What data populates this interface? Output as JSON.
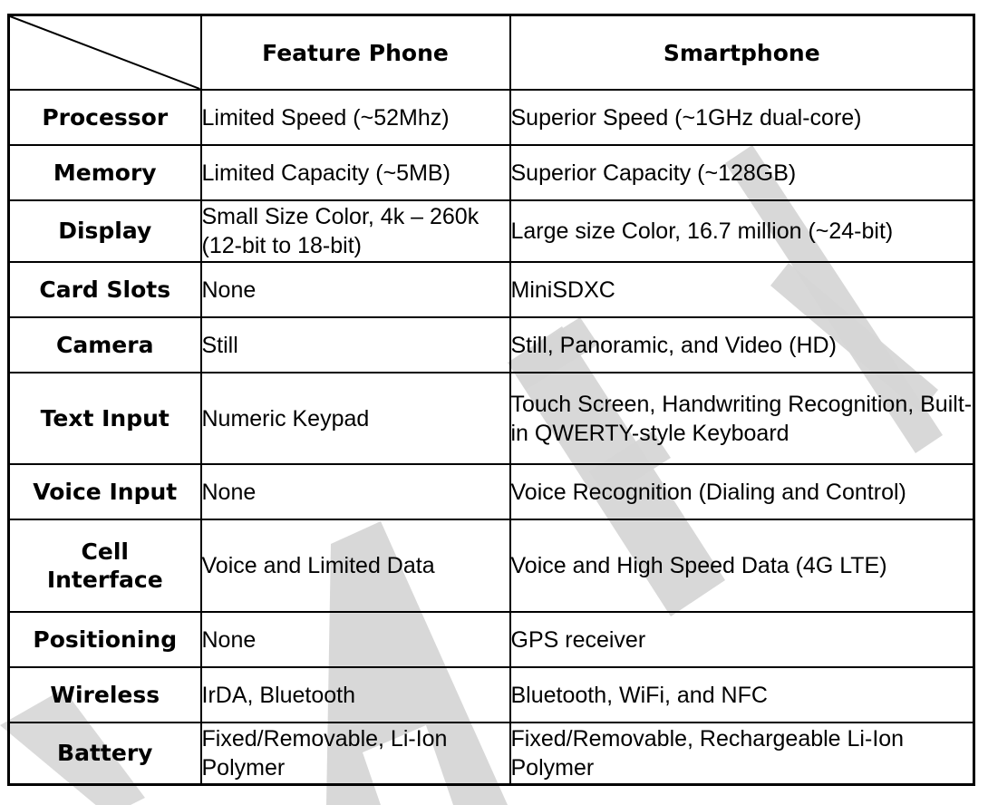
{
  "watermark": {
    "text": "DRAFT",
    "color": "#d3d3d3"
  },
  "table": {
    "columns": [
      "Feature Phone",
      "Smartphone"
    ],
    "rows": [
      {
        "label": "Processor",
        "feature_phone": "Limited Speed (~52Mhz)",
        "smartphone": "Superior Speed (~1GHz dual-core)"
      },
      {
        "label": "Memory",
        "feature_phone": "Limited Capacity (~5MB)",
        "smartphone": "Superior Capacity  (~128GB)"
      },
      {
        "label": "Display",
        "feature_phone": "Small Size Color, 4k – 260k (12-bit to 18-bit)",
        "smartphone": "Large size Color, 16.7 million (~24-bit)"
      },
      {
        "label": "Card Slots",
        "feature_phone": "None",
        "smartphone": "MiniSDXC"
      },
      {
        "label": "Camera",
        "feature_phone": "Still",
        "smartphone": "Still, Panoramic, and Video (HD)"
      },
      {
        "label": "Text Input",
        "feature_phone": "Numeric Keypad",
        "smartphone": "Touch Screen, Handwriting Recognition, Built-in QWERTY-style Keyboard"
      },
      {
        "label": "Voice Input",
        "feature_phone": "None",
        "smartphone": "Voice Recognition (Dialing and Control)"
      },
      {
        "label": "Cell Interface",
        "feature_phone": "Voice and Limited Data",
        "smartphone": "Voice and High Speed Data (4G LTE)"
      },
      {
        "label": "Positioning",
        "feature_phone": "None",
        "smartphone": "GPS receiver"
      },
      {
        "label": "Wireless",
        "feature_phone": "IrDA, Bluetooth",
        "smartphone": "Bluetooth, WiFi, and NFC"
      },
      {
        "label": "Battery",
        "feature_phone": "Fixed/Removable, Li-Ion Polymer",
        "smartphone": "Fixed/Removable, Rechargeable Li-Ion Polymer"
      }
    ]
  }
}
